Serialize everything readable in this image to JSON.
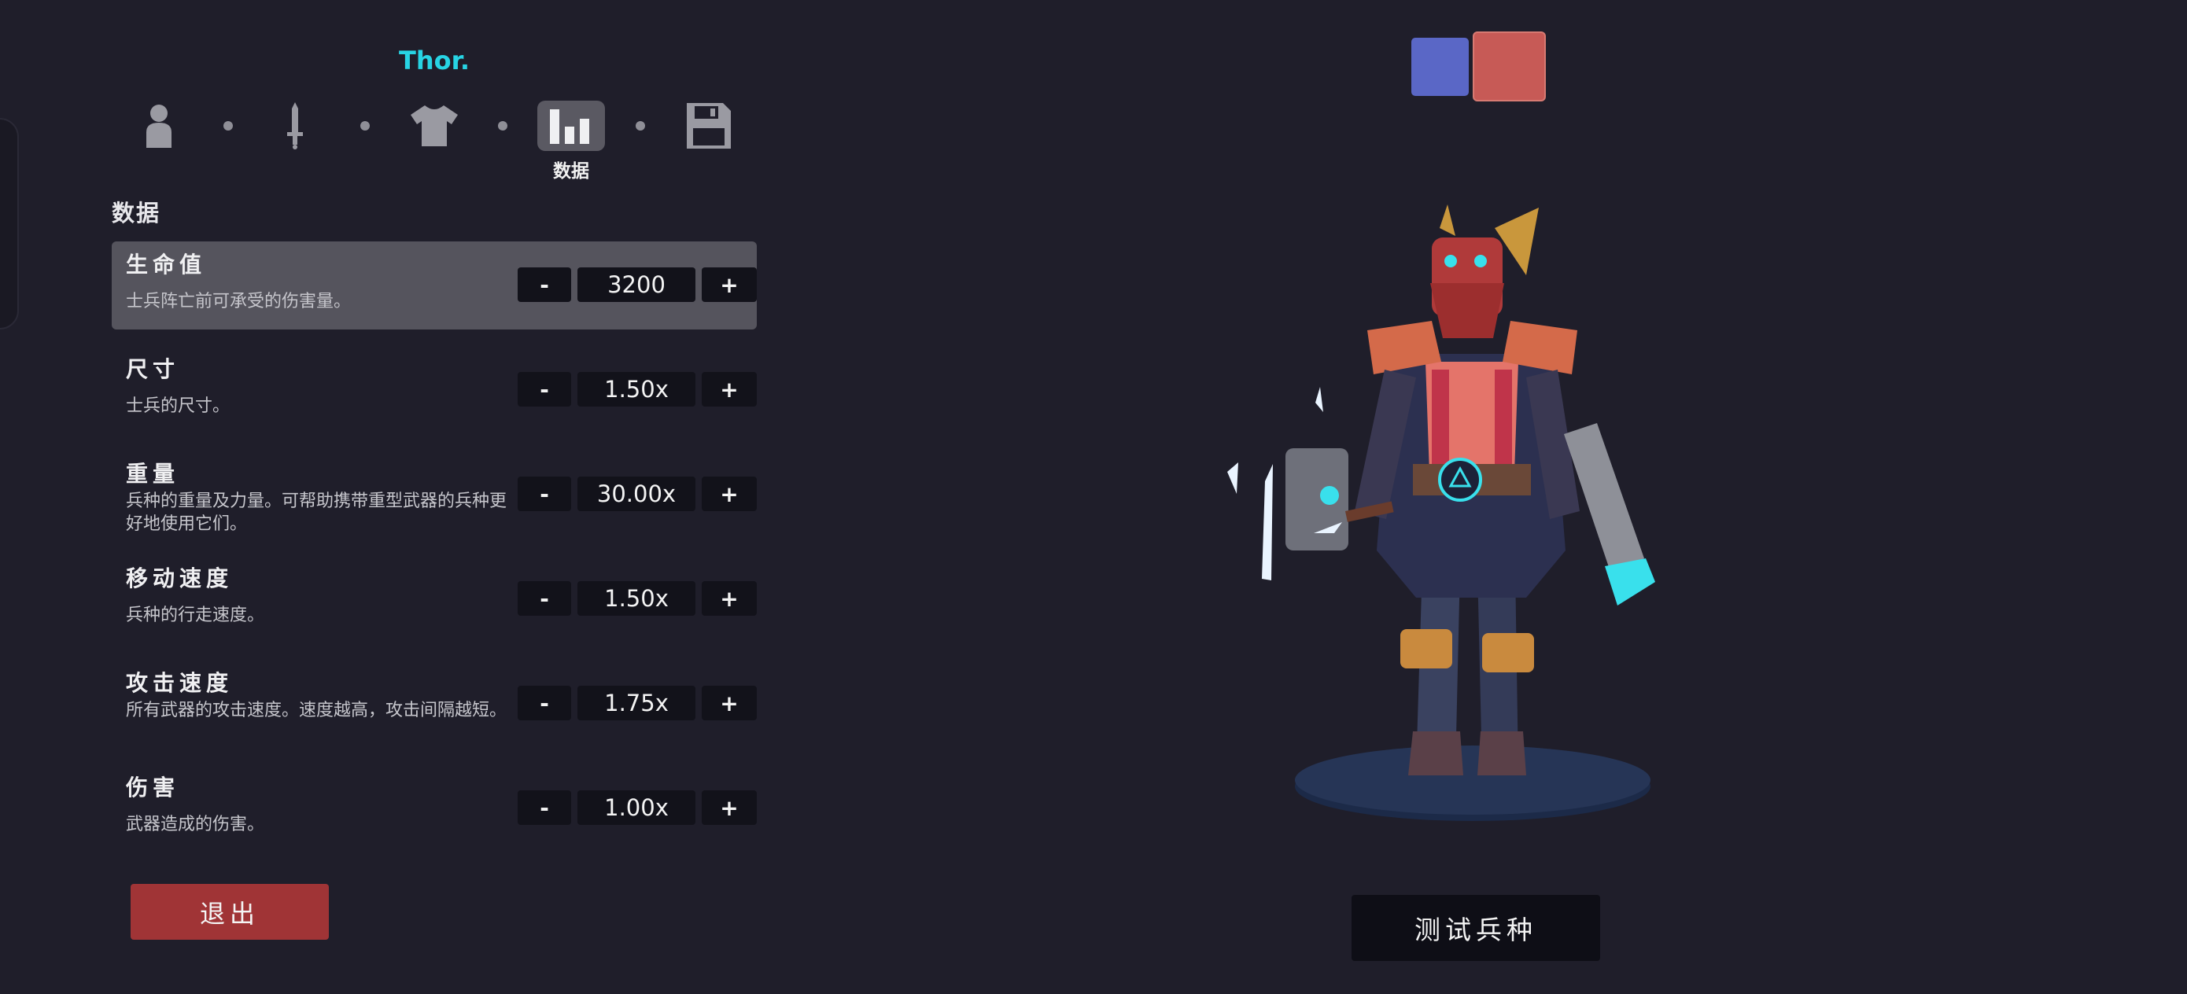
{
  "unit_name": "Thor.",
  "steps": [
    {
      "icon": "person-icon",
      "active": false
    },
    {
      "icon": "sword-icon",
      "active": false
    },
    {
      "icon": "shirt-icon",
      "active": false
    },
    {
      "icon": "bar-chart-icon",
      "active": true,
      "label": "数据"
    },
    {
      "icon": "save-disk-icon",
      "active": false
    }
  ],
  "section_title": "数据",
  "stats": [
    {
      "name": "生命值",
      "description": "士兵阵亡前可承受的伤害量。",
      "value": "3200"
    },
    {
      "name": "尺寸",
      "description": "士兵的尺寸。",
      "value": "1.50x"
    },
    {
      "name": "重量",
      "description": "兵种的重量及力量。可帮助携带重型武器的兵种更好地使用它们。",
      "value": "30.00x"
    },
    {
      "name": "移动速度",
      "description": "兵种的行走速度。",
      "value": "1.50x"
    },
    {
      "name": "攻击速度",
      "description": "所有武器的攻击速度。速度越高，攻击间隔越短。",
      "value": "1.75x"
    },
    {
      "name": "伤害",
      "description": "武器造成的伤害。",
      "value": "1.00x"
    }
  ],
  "controls": {
    "minus": "-",
    "plus": "+"
  },
  "exit_label": "退出",
  "test_label": "测试兵种",
  "team_colors": {
    "blue": "#5a67c6",
    "red": "#c75a56"
  },
  "accent_color": "#27d4e4"
}
